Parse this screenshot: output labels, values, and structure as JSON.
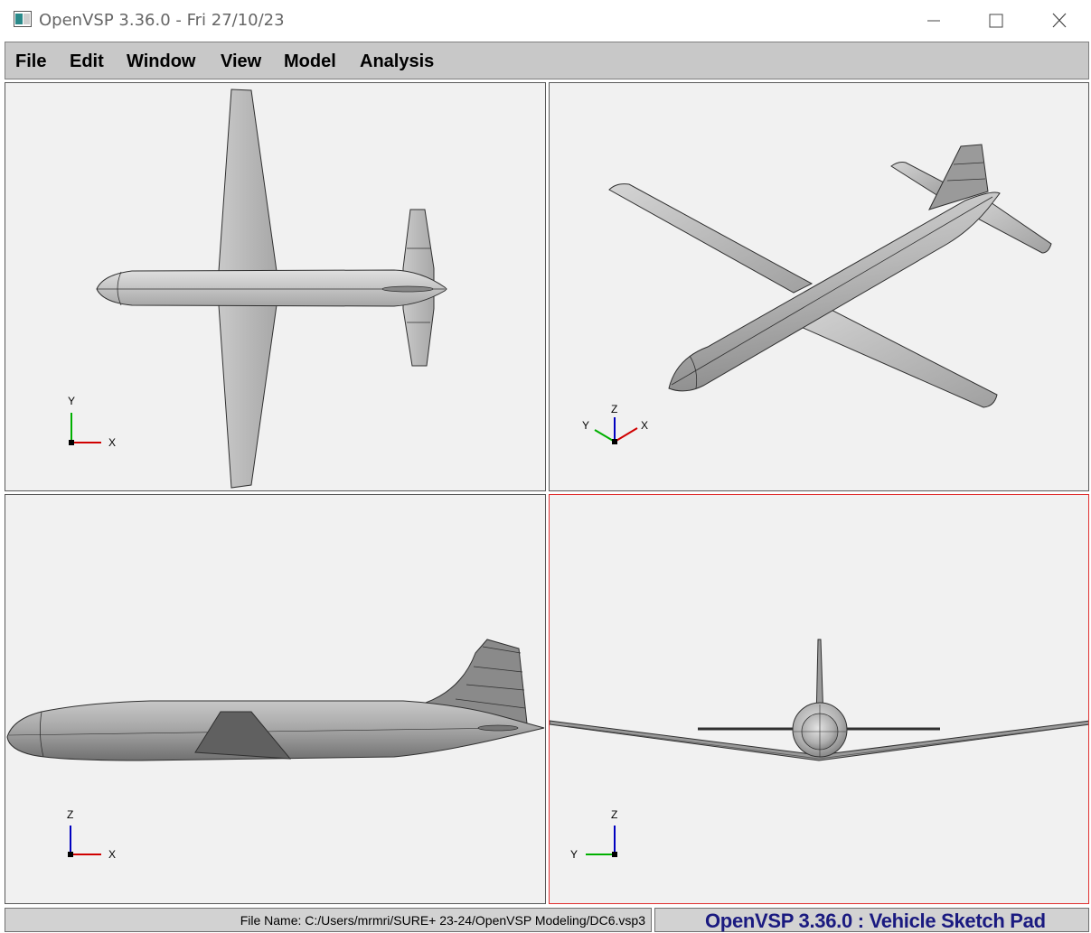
{
  "window": {
    "title": "OpenVSP 3.36.0 - Fri 27/10/23",
    "buttons": [
      "minimize",
      "maximize",
      "close"
    ]
  },
  "menu": [
    "File",
    "Edit",
    "Window",
    "View",
    "Model",
    "Analysis"
  ],
  "viewports": {
    "top": {
      "axes": {
        "vertical": "Y",
        "horizontal": "X"
      }
    },
    "iso": {
      "axes": {
        "z": "Z",
        "y": "Y",
        "x": "X"
      }
    },
    "side": {
      "axes": {
        "vertical": "Z",
        "horizontal": "X"
      }
    },
    "front": {
      "axes": {
        "vertical": "Z",
        "horizontal": "Y"
      },
      "active": true
    }
  },
  "status": {
    "file_name": "File Name: C:/Users/mrmri/SURE+ 23-24/OpenVSP Modeling/DC6.vsp3",
    "banner": "OpenVSP 3.36.0 : Vehicle Sketch Pad"
  },
  "colors": {
    "viewport_bg": "#f1f1f1",
    "active_border": "#e03030",
    "axis_x": "#d00000",
    "axis_y": "#00b000",
    "axis_z": "#0000c0",
    "banner_text": "#1a1a80"
  }
}
